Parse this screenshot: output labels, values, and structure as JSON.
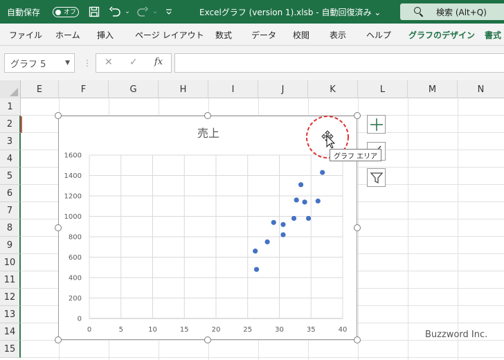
{
  "titlebar": {
    "autosave_label": "自動保存",
    "autosave_state": "オフ",
    "document_title": "Excelグラフ (version 1).xlsb  -  自動回復済み ⌄",
    "search_label": "検索 (Alt+Q)"
  },
  "ribbon": {
    "tabs": [
      "ファイル",
      "ホーム",
      "挿入",
      "ページ レイアウト",
      "数式",
      "データ",
      "校閲",
      "表示",
      "ヘルプ",
      "グラフのデザイン",
      "書式"
    ]
  },
  "formula_bar": {
    "name_box": "グラフ 5",
    "cancel_symbol": "✕",
    "enter_symbol": "✓",
    "function_symbol": "fx"
  },
  "sheet": {
    "columns": [
      "E",
      "F",
      "G",
      "H",
      "I",
      "J",
      "K",
      "L",
      "M",
      "N"
    ],
    "rows": [
      "1",
      "2",
      "3",
      "4",
      "5",
      "6",
      "7",
      "8",
      "9",
      "10",
      "11",
      "12",
      "13",
      "14",
      "15"
    ]
  },
  "chart_data": {
    "type": "scatter",
    "title": "売上",
    "xlabel": "",
    "ylabel": "",
    "xlim": [
      0,
      40
    ],
    "ylim": [
      0,
      1600
    ],
    "x_ticks": [
      0,
      5,
      10,
      15,
      20,
      25,
      30,
      35,
      40
    ],
    "y_ticks": [
      0,
      200,
      400,
      600,
      800,
      1000,
      1200,
      1400,
      1600
    ],
    "grid": true,
    "legend": "none",
    "series": [
      {
        "color": "#4472c4",
        "points": [
          {
            "x": 26.2,
            "y": 660
          },
          {
            "x": 26.4,
            "y": 480
          },
          {
            "x": 28.1,
            "y": 750
          },
          {
            "x": 29.1,
            "y": 940
          },
          {
            "x": 30.6,
            "y": 920
          },
          {
            "x": 30.6,
            "y": 820
          },
          {
            "x": 32.3,
            "y": 980
          },
          {
            "x": 32.7,
            "y": 1160
          },
          {
            "x": 33.4,
            "y": 1310
          },
          {
            "x": 34.0,
            "y": 1140
          },
          {
            "x": 34.6,
            "y": 980
          },
          {
            "x": 36.1,
            "y": 1150
          },
          {
            "x": 36.8,
            "y": 1430
          }
        ]
      }
    ]
  },
  "tooltip": "グラフ エリア",
  "watermark": "Buzzword Inc.",
  "colors": {
    "titlebar": "#1e7145",
    "marker": "#4472c4",
    "cursor_highlight": "#e03030"
  }
}
